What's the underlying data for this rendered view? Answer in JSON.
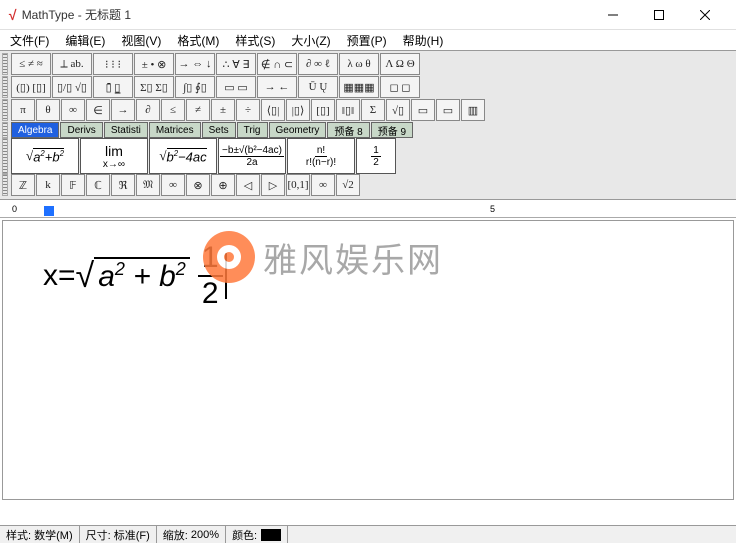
{
  "window": {
    "app": "MathType",
    "title": "MathType - 无标题 1"
  },
  "menu": [
    "文件(F)",
    "编辑(E)",
    "视图(V)",
    "格式(M)",
    "样式(S)",
    "大小(Z)",
    "预置(P)",
    "帮助(H)"
  ],
  "palette_row1": [
    "≤ ≠ ≈",
    "⟂ ab.",
    "⁝ ⁝ ⁝",
    "± • ⊗",
    "→ ⇔ ↓",
    "∴ ∀ ∃",
    "∉ ∩ ⊂",
    "∂ ∞ ℓ",
    "λ ω θ",
    "Λ Ω Θ"
  ],
  "palette_row2": [
    "(▯) [▯]",
    "▯/▯ √▯",
    "▯̄ ▯̲",
    "Σ▯ Σ▯",
    "∫▯ ∮▯",
    "▭ ▭",
    "→ ←",
    "Ū Ų",
    "▦▦▦",
    "◻ ◻"
  ],
  "palette_row3": [
    "π",
    "θ",
    "∞",
    "∈",
    "→",
    "∂",
    "≤",
    "≠",
    "±",
    "÷",
    "⟨▯|",
    "|▯⟩",
    "[▯]",
    "‖▯‖",
    "Σ",
    "√▯",
    "▭",
    "▭",
    "▥"
  ],
  "tabs": [
    "Algebra",
    "Derivs",
    "Statisti",
    "Matrices",
    "Sets",
    "Trig",
    "Geometry",
    "预备 8",
    "预备 9"
  ],
  "active_tab": 0,
  "templates": {
    "t1": "√(a²+b²)",
    "t2_top": "lim",
    "t2_bot": "x→∞",
    "t3": "√(b²−4ac)",
    "t4_top": "−b±√(b²−4ac)",
    "t4_bot": "2a",
    "t5_top": "n!",
    "t5_bot": "r!(n−r)!",
    "t6_top": "1",
    "t6_bot": "2"
  },
  "palette_row5": [
    "ℤ",
    "k",
    "𝔽",
    "ℂ",
    "ℜ",
    "𝔐",
    "∞",
    "⊗",
    "⊕",
    "◁",
    "▷",
    "[0,1]",
    "∞",
    "√2"
  ],
  "ruler": {
    "marks": [
      "0",
      "5"
    ]
  },
  "equation": {
    "lhs": "x=",
    "rad_a": "a",
    "rad_b": "b",
    "sup": "2",
    "plus": " + ",
    "frac_n": "1",
    "frac_d": "2"
  },
  "watermark": "雅风娱乐网",
  "status": {
    "style_lbl": "样式:",
    "style_val": "数学(M)",
    "size_lbl": "尺寸:",
    "size_val": "标准(F)",
    "zoom_lbl": "缩放:",
    "zoom_val": "200%",
    "color_lbl": "颜色:",
    "color_val": "#000000"
  }
}
